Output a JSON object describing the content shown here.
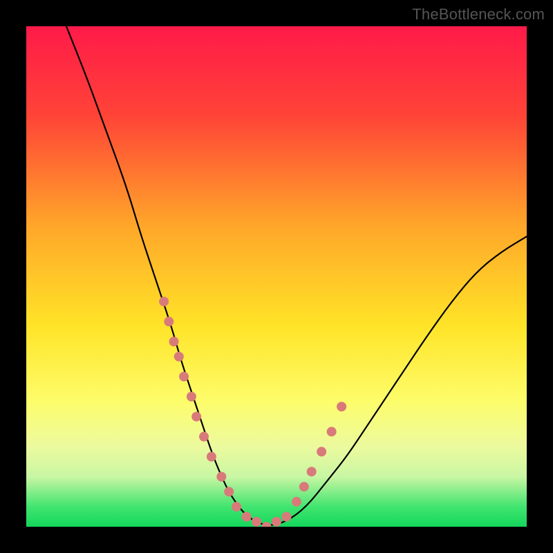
{
  "watermark": "TheBottleneck.com",
  "chart_data": {
    "type": "line",
    "title": "",
    "xlabel": "",
    "ylabel": "",
    "xlim": [
      0,
      100
    ],
    "ylim": [
      0,
      100
    ],
    "grid": false,
    "legend": false,
    "background": {
      "type": "vertical-gradient",
      "stops": [
        {
          "offset": 0,
          "color": "#ff1a49"
        },
        {
          "offset": 18,
          "color": "#ff4437"
        },
        {
          "offset": 40,
          "color": "#ffa729"
        },
        {
          "offset": 60,
          "color": "#ffe428"
        },
        {
          "offset": 75,
          "color": "#fdfd6b"
        },
        {
          "offset": 84,
          "color": "#ecfa9e"
        },
        {
          "offset": 90,
          "color": "#c9f6a3"
        },
        {
          "offset": 96,
          "color": "#41e56f"
        },
        {
          "offset": 100,
          "color": "#14d65c"
        }
      ]
    },
    "series": [
      {
        "name": "bottleneck-curve",
        "color": "#000000",
        "x": [
          8,
          12,
          16,
          20,
          23,
          26,
          29,
          31,
          33,
          35,
          37,
          39,
          41,
          44,
          48,
          52,
          56,
          60,
          64,
          68,
          72,
          76,
          80,
          85,
          90,
          95,
          100
        ],
        "y": [
          100,
          90,
          79,
          68,
          58,
          49,
          40,
          33,
          27,
          21,
          15,
          10,
          6,
          2,
          0,
          1,
          4,
          9,
          14,
          20,
          26,
          32,
          38,
          45,
          51,
          55,
          58
        ]
      }
    ],
    "scatter": {
      "name": "highlighted-points",
      "color": "#d97a7a",
      "radius": 7,
      "x": [
        27.5,
        28.5,
        29.5,
        30.5,
        31.5,
        33.0,
        34.0,
        35.5,
        37.0,
        39.0,
        40.5,
        42.0,
        44.0,
        46.0,
        48.0,
        50.0,
        52.0,
        54.0,
        55.5,
        57.0,
        59.0,
        61.0,
        63.0
      ],
      "y": [
        45,
        41,
        37,
        34,
        30,
        26,
        22,
        18,
        14,
        10,
        7,
        4,
        2,
        1,
        0,
        1,
        2,
        5,
        8,
        11,
        15,
        19,
        24
      ]
    }
  }
}
